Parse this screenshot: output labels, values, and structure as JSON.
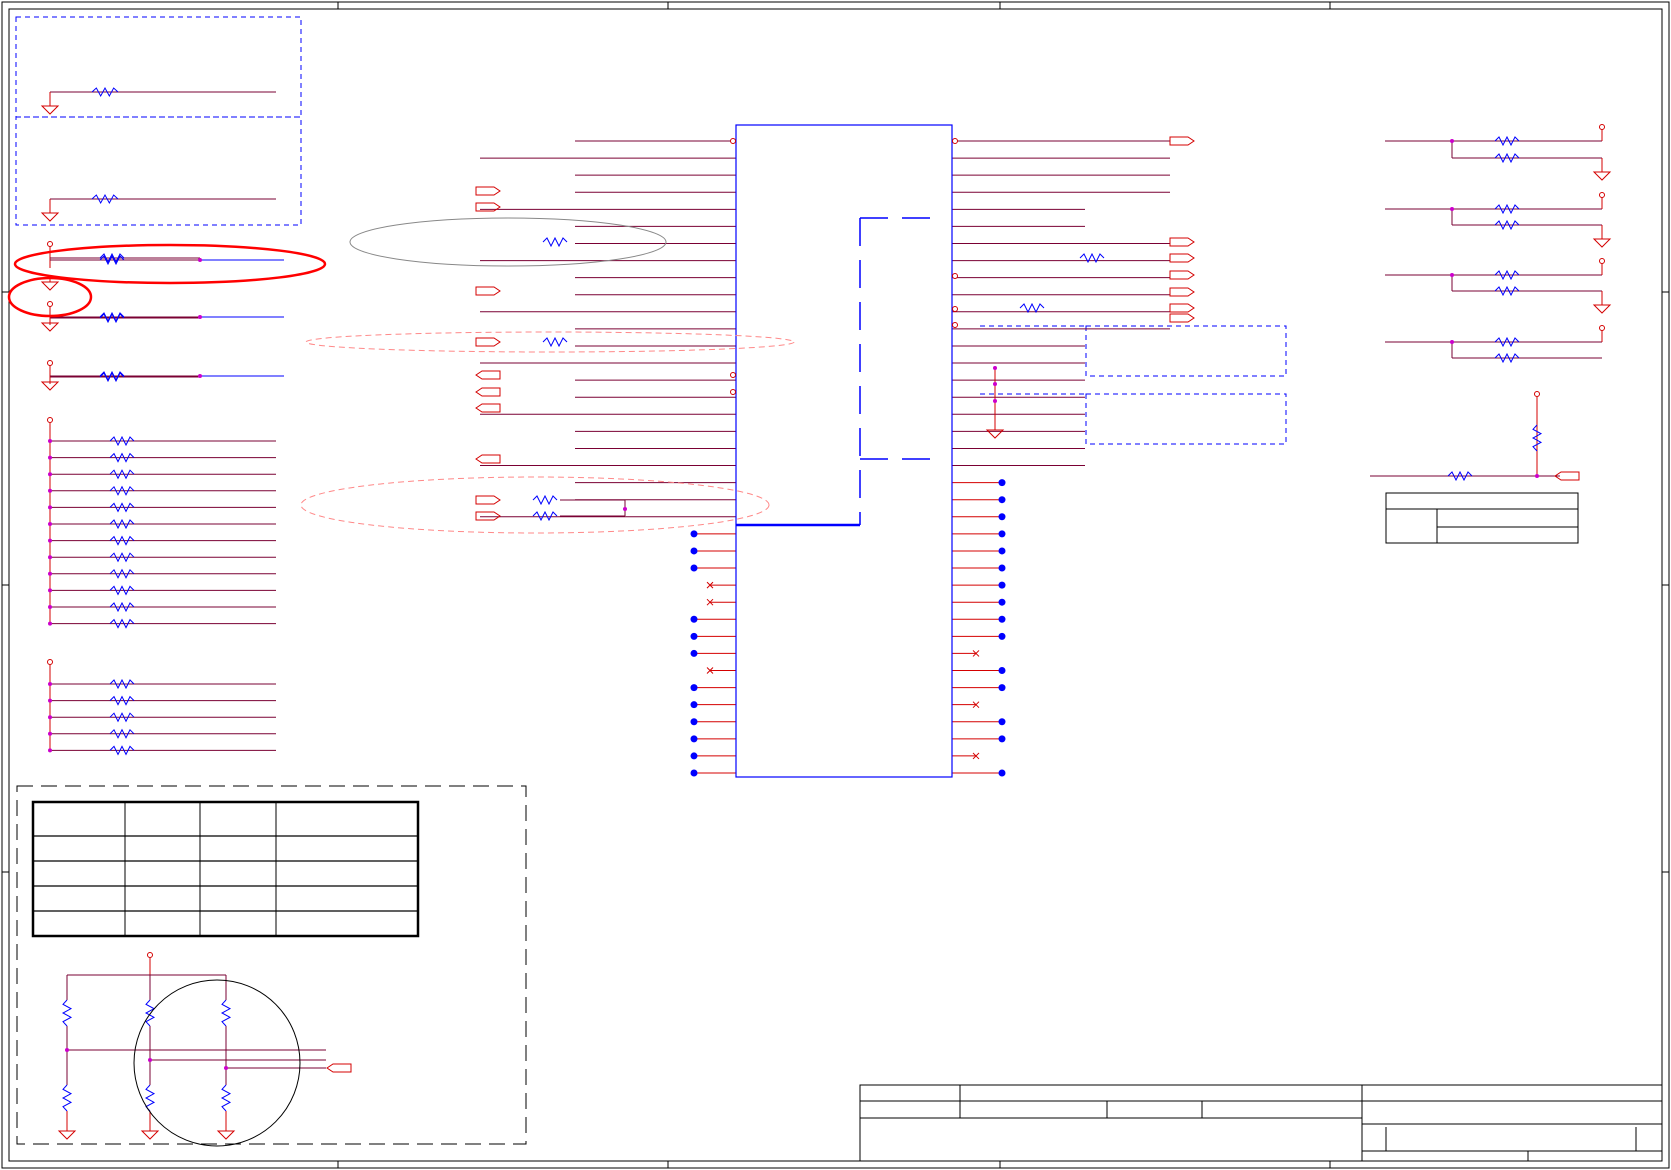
{
  "sheet": {
    "kind": "schematic",
    "title_block": {
      "title": "",
      "size": "",
      "document_number": "",
      "revision": "",
      "date": "",
      "sheet": ""
    }
  },
  "colors": {
    "wire": "#d40000",
    "net": "#7a0033",
    "component": "#0000ff",
    "junction": "#cc00cc",
    "highlight": "#ff0000",
    "annotation_gray": "#888888",
    "annotation_light": "#ff8888",
    "border": "#000000"
  },
  "icons": {
    "ground": "ground-icon",
    "power": "power-pin-icon",
    "resistor": "resistor-icon",
    "port": "off-page-connector-icon",
    "junction": "junction-dot-icon",
    "no_connect": "no-connect-icon"
  },
  "components": {
    "main_ic": {
      "left_pins": 38,
      "right_pins": 38
    },
    "left_pullup_bank_1": {
      "resistors": 12
    },
    "left_pullup_bank_2": {
      "resistors": 5
    },
    "right_bias_resistors": {
      "resistors": 8
    },
    "strap_section": {
      "resistors": 6
    }
  },
  "tables": {
    "strap_table": {
      "rows": 4,
      "columns": 4
    },
    "small_table": {
      "rows": 3,
      "columns": 2
    }
  }
}
